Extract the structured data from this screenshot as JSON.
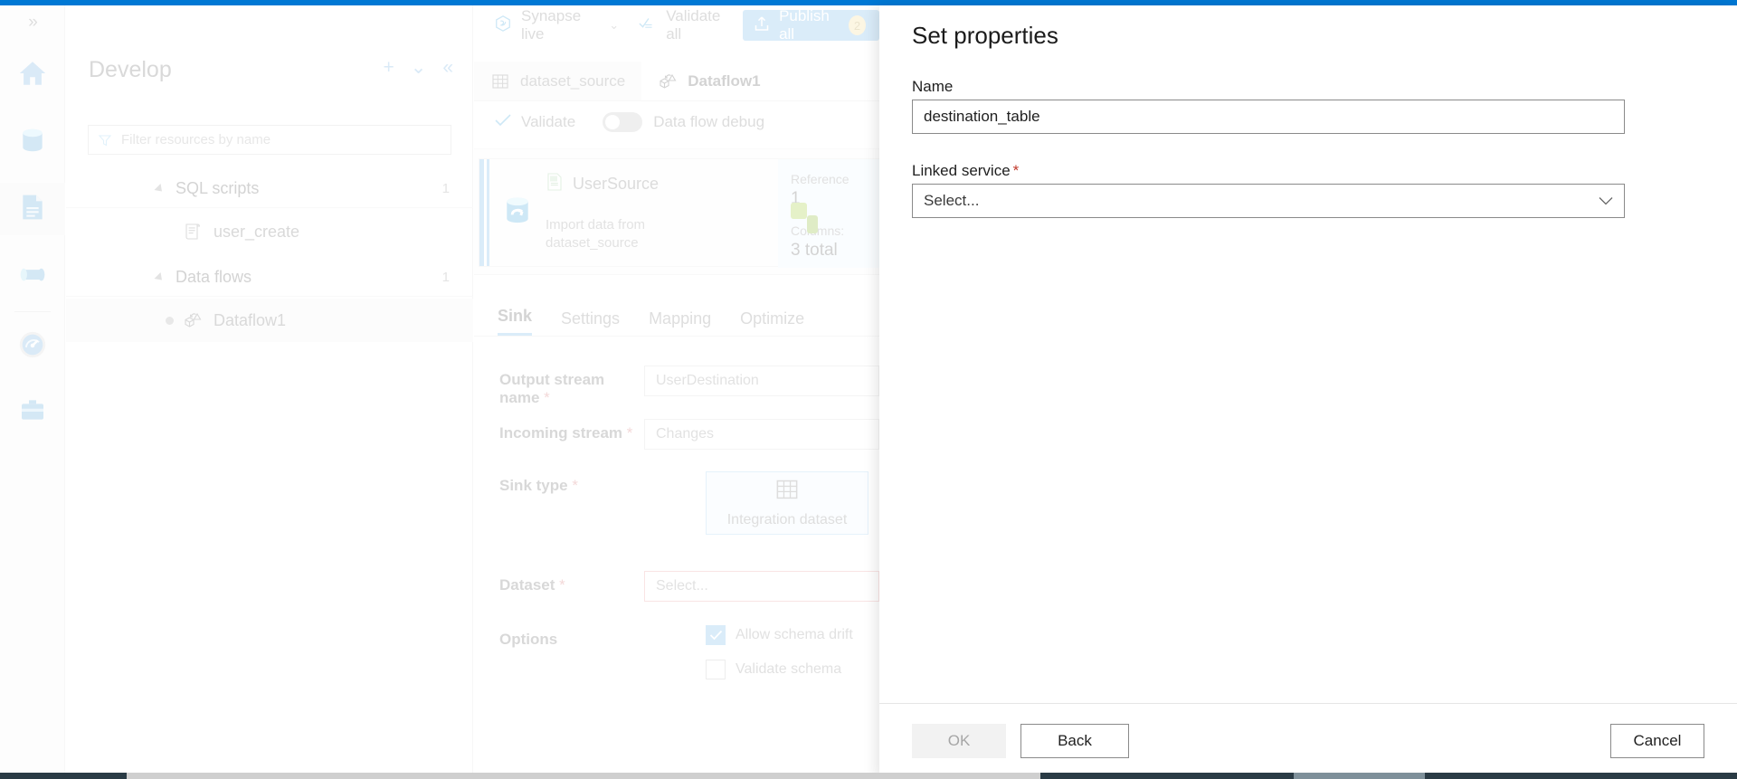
{
  "theme": {
    "accent": "#0078d4",
    "accent_soft": "#9ecdf0",
    "required_red": "#c0392b",
    "badge_bg": "#f7e6b6"
  },
  "rail": {
    "expand_icon": "chevron-double-right-icon",
    "items": [
      {
        "id": "home",
        "icon": "home-icon",
        "active": false
      },
      {
        "id": "data",
        "icon": "database-icon",
        "active": false
      },
      {
        "id": "develop",
        "icon": "document-icon",
        "active": true
      },
      {
        "id": "integrate",
        "icon": "pipeline-icon",
        "active": false
      },
      {
        "id": "monitor",
        "icon": "gauge-icon",
        "active": false
      },
      {
        "id": "manage",
        "icon": "briefcase-icon",
        "active": false
      }
    ]
  },
  "toolbar": {
    "workspace_mode": "Synapse live",
    "workspace_caret": "chevron-down-icon",
    "validate_all": "Validate all",
    "publish_all": "Publish all",
    "publish_count": "2"
  },
  "develop": {
    "title": "Develop",
    "add_icon": "plus-icon",
    "more_icon": "chevron-double-down-icon",
    "collapse_icon": "chevron-double-left-icon",
    "filter": {
      "placeholder": "Filter resources by name",
      "value": "",
      "icon": "filter-icon"
    },
    "groups": [
      {
        "label": "SQL scripts",
        "count": "1",
        "items": [
          {
            "label": "user_create",
            "icon": "sql-script-icon",
            "selected": false
          }
        ]
      },
      {
        "label": "Data flows",
        "count": "1",
        "items": [
          {
            "label": "Dataflow1",
            "icon": "dataflow-icon",
            "selected": true
          }
        ]
      }
    ]
  },
  "editor": {
    "tabs": [
      {
        "label": "dataset_source",
        "icon": "table-icon",
        "active": false
      },
      {
        "label": "Dataflow1",
        "icon": "dataflow-icon",
        "active": true
      }
    ],
    "validate": "Validate",
    "validate_icon": "check-icon",
    "debug_toggle": {
      "label": "Data flow debug",
      "on": false
    }
  },
  "canvas": {
    "node": {
      "title": "UserSource",
      "title_icon": "csv-file-icon",
      "source_icon": "source-database-icon",
      "subtitle": "Import data from\ndataset_source",
      "stats": [
        {
          "key": "Reference",
          "value": "1"
        },
        {
          "key": "Columns:",
          "value": "3 total"
        }
      ],
      "add_icon": "plus-icon"
    }
  },
  "properties": {
    "tabs": [
      {
        "label": "Sink",
        "active": true
      },
      {
        "label": "Settings",
        "active": false
      },
      {
        "label": "Mapping",
        "active": false
      },
      {
        "label": "Optimize",
        "active": false
      }
    ],
    "fields": {
      "output_stream_name": {
        "label": "Output stream name",
        "required": true,
        "value": "UserDestination"
      },
      "incoming_stream": {
        "label": "Incoming stream",
        "required": true,
        "value": "Changes"
      },
      "sink_type": {
        "label": "Sink type",
        "required": true,
        "selected": "Integration dataset",
        "icon": "table-icon"
      },
      "dataset": {
        "label": "Dataset",
        "required": true,
        "value": "Select...",
        "error": true
      },
      "options": {
        "label": "Options",
        "checkboxes": [
          {
            "label": "Allow schema drift",
            "checked": true
          },
          {
            "label": "Validate schema",
            "checked": false
          }
        ]
      }
    }
  },
  "modal": {
    "title": "Set properties",
    "name": {
      "label": "Name",
      "value": "destination_table"
    },
    "linked_service": {
      "label": "Linked service",
      "required": true,
      "value": "Select...",
      "caret_icon": "chevron-down-icon"
    },
    "buttons": {
      "ok": "OK",
      "back": "Back",
      "cancel": "Cancel"
    }
  }
}
